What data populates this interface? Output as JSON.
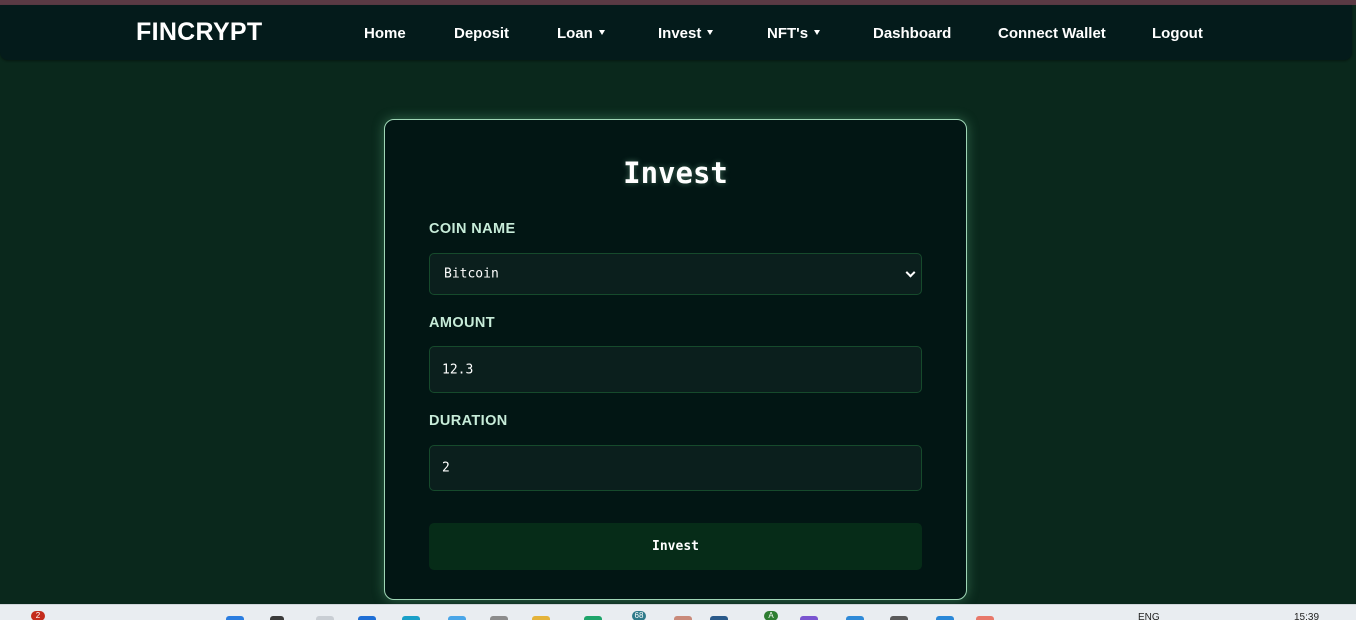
{
  "app": {
    "brand": "FINCRYPT"
  },
  "nav": {
    "home": "Home",
    "deposit": "Deposit",
    "loan": "Loan",
    "invest": "Invest",
    "nfts": "NFT's",
    "dashboard": "Dashboard",
    "connect_wallet": "Connect Wallet",
    "logout": "Logout"
  },
  "form": {
    "title": "Invest",
    "coin_label": "COIN NAME",
    "coin_value": "Bitcoin",
    "amount_label": "AMOUNT",
    "amount_value": "12.3",
    "duration_label": "DURATION",
    "duration_value": "2",
    "submit_label": "Invest"
  },
  "taskbar": {
    "notification_count": "2",
    "app_badge_count": "68",
    "app_badge_letter": "A",
    "language": "ENG",
    "time": "15:39"
  },
  "colors": {
    "page_bg": "#0a281c",
    "navbar_bg": "#041b1b",
    "card_bg": "#021614",
    "card_border": "#9fd6b6",
    "button_bg": "#062c18"
  }
}
